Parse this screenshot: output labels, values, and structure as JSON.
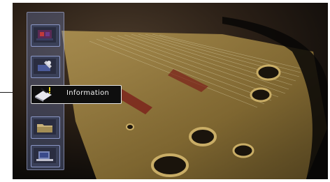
{
  "menu": {
    "items": [
      {
        "id": "scene",
        "icon": "scene-icon"
      },
      {
        "id": "setup",
        "icon": "tools-icon"
      },
      {
        "id": "information",
        "icon": "information-icon",
        "label": "Information",
        "selected": true
      },
      {
        "id": "file",
        "icon": "folder-icon"
      },
      {
        "id": "display",
        "icon": "display-icon"
      }
    ]
  },
  "colors": {
    "strip_bg": "#6e82be",
    "item_border": "#8b97c6",
    "selected_border": "#e6e6e6",
    "selected_bg": "#0e0e0e",
    "label_text": "#f2f2f2"
  }
}
